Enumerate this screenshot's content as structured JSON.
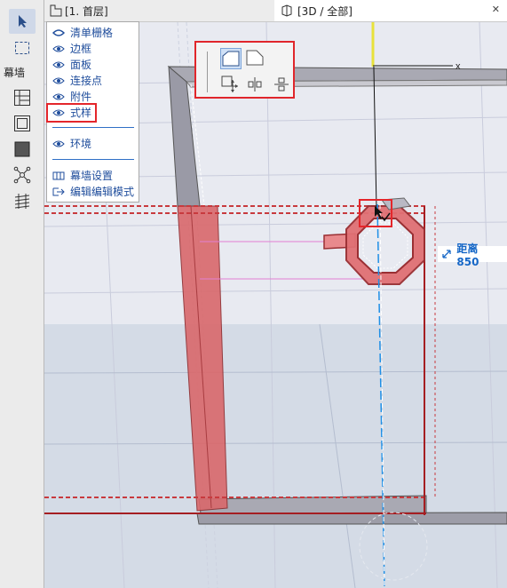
{
  "toolbox": {
    "section_label": "幕墙",
    "tools": [
      "arrow-select-icon",
      "marquee-icon",
      "curtain-wall-scheme-icon",
      "frame-tool-icon",
      "panel-tool-icon",
      "junction-tool-icon",
      "accessory-tool-icon"
    ]
  },
  "tabs": {
    "floor_plan": "[1. 首层]",
    "view3d": "[3D / 全部]"
  },
  "panel": {
    "items": [
      "清单栅格",
      "边框",
      "面板",
      "连接点",
      "附件",
      "式样",
      "环境",
      "幕墙设置",
      "编辑编辑模式"
    ]
  },
  "axis_label": "x",
  "distance_label": "距离 850",
  "colors": {
    "highlight": "#e4262b",
    "link": "#1f4d9c",
    "frame": "#d9686b",
    "guide": "#1f8fe6"
  }
}
